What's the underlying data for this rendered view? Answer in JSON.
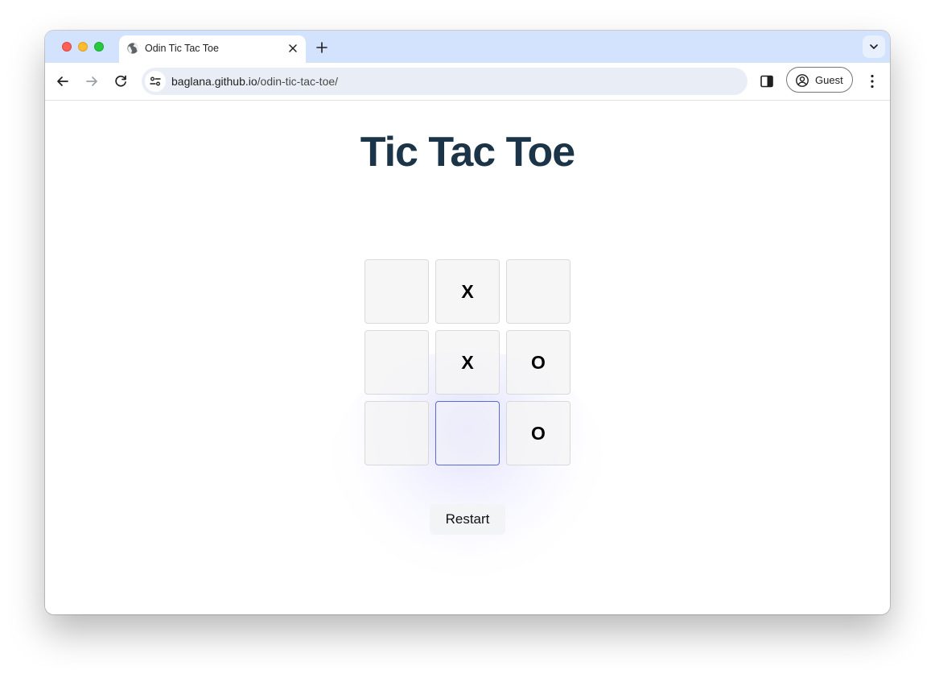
{
  "browser": {
    "tab_title": "Odin Tic Tac Toe",
    "url_host": "baglana.github.io",
    "url_path": "/odin-tic-tac-toe/",
    "profile_label": "Guest"
  },
  "game": {
    "title": "Tic Tac Toe",
    "cells": [
      "",
      "X",
      "",
      "",
      "X",
      "O",
      "",
      "",
      "O"
    ],
    "restart_label": "Restart"
  },
  "colors": {
    "title": "#1b3447",
    "tab_strip": "#d3e3fd",
    "focus_outline": "#5b6bd6"
  },
  "icons": [
    "globe-icon",
    "close-icon",
    "plus-icon",
    "chevron-down-icon",
    "back-arrow-icon",
    "forward-arrow-icon",
    "reload-icon",
    "tune-icon",
    "side-panel-icon",
    "profile-icon",
    "more-vert-icon"
  ]
}
